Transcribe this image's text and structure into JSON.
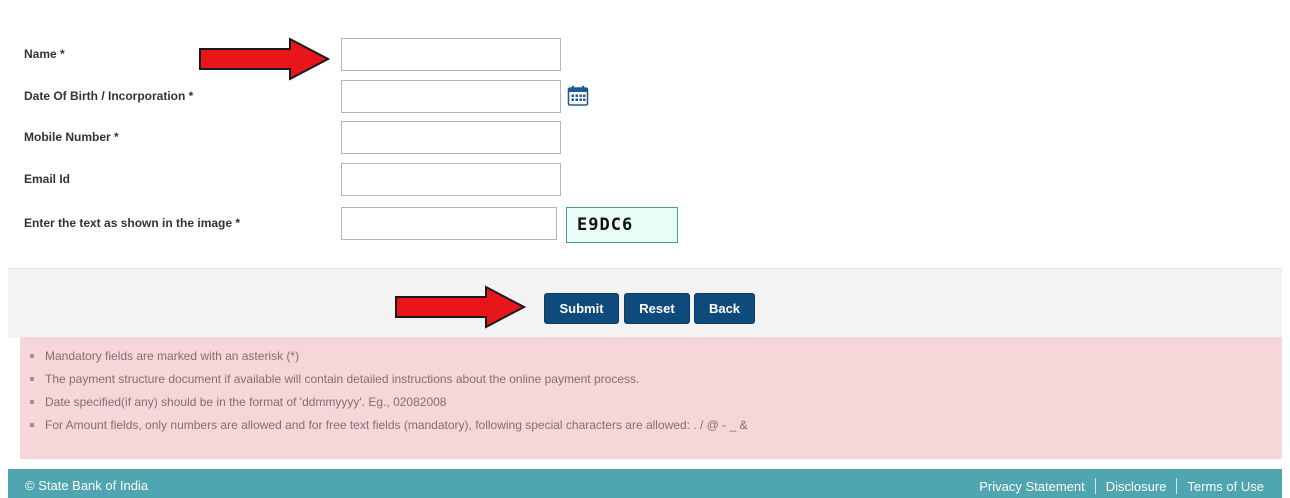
{
  "form": {
    "fields": [
      {
        "label": "Name *",
        "value": "",
        "placeholder": ""
      },
      {
        "label": "Date Of Birth / Incorporation *",
        "value": "",
        "placeholder": ""
      },
      {
        "label": "Mobile Number *",
        "value": "",
        "placeholder": ""
      },
      {
        "label": "Email Id",
        "value": "",
        "placeholder": ""
      },
      {
        "label": "Enter the text as shown in the image *",
        "value": "",
        "placeholder": ""
      }
    ],
    "captcha_text": "E9DC6",
    "calendar_icon": "calendar-icon"
  },
  "buttons": {
    "submit": "Submit",
    "reset": "Reset",
    "back": "Back"
  },
  "notes": [
    "Mandatory fields are marked with an asterisk (*)",
    "The payment structure document if available will contain detailed instructions about the online payment process.",
    "Date specified(if any) should be in the format of 'ddmmyyyy'. Eg., 02082008",
    "For Amount fields, only numbers are allowed and for free text fields (mandatory), following special characters are allowed: . / @ - _ &"
  ],
  "footer": {
    "copyright": "© State Bank of India",
    "links": [
      "Privacy Statement",
      "Disclosure",
      "Terms of Use"
    ]
  },
  "colors": {
    "button": "#0f4a7d",
    "notes_bg": "#f6d6d8",
    "footer_bg": "#4fa5b0",
    "arrow": "#e8151b"
  }
}
